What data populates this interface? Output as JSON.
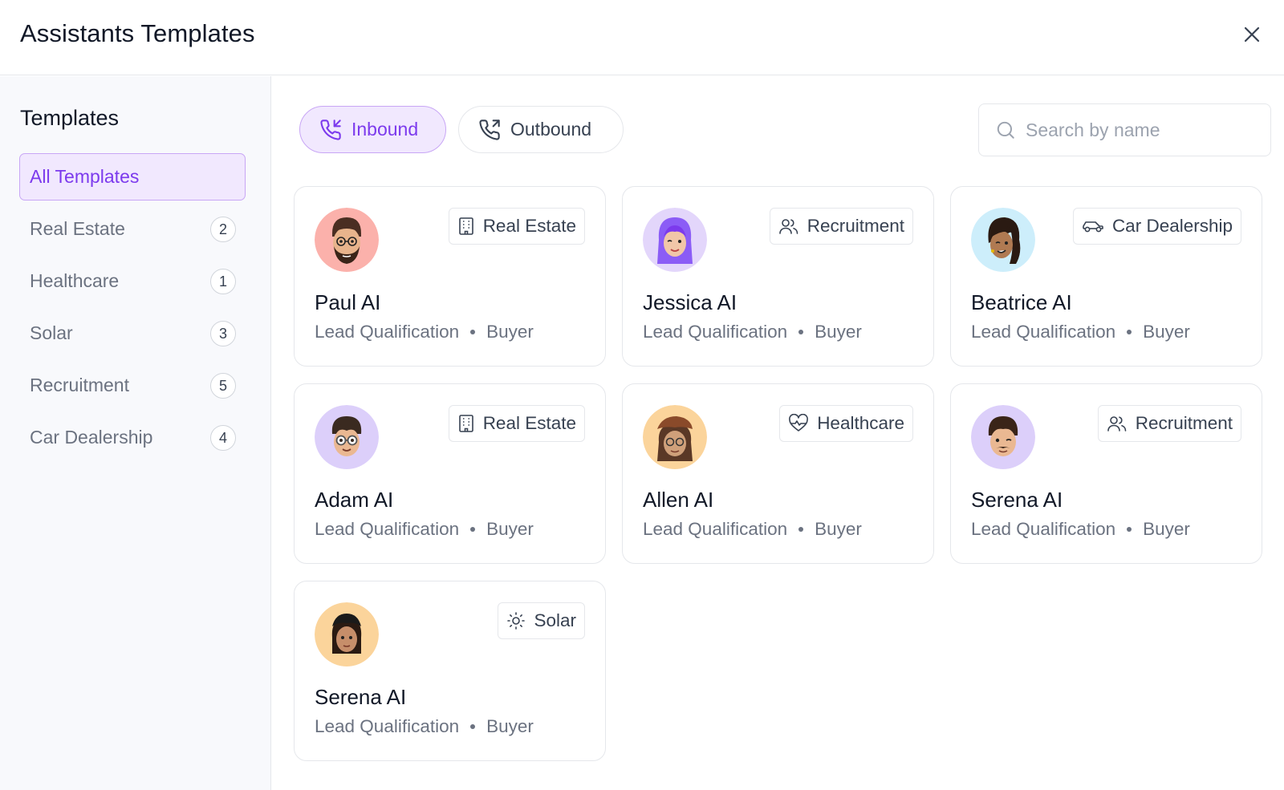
{
  "header": {
    "title": "Assistants Templates"
  },
  "sidebar": {
    "heading": "Templates",
    "items": [
      {
        "label": "All Templates",
        "count": null,
        "active": true
      },
      {
        "label": "Real Estate",
        "count": "2"
      },
      {
        "label": "Healthcare",
        "count": "1"
      },
      {
        "label": "Solar",
        "count": "3"
      },
      {
        "label": "Recruitment",
        "count": "5"
      },
      {
        "label": "Car Dealership",
        "count": "4"
      }
    ]
  },
  "toggles": {
    "inbound": "Inbound",
    "outbound": "Outbound",
    "selected": "Inbound"
  },
  "search": {
    "placeholder": "Search by name",
    "value": ""
  },
  "cards": [
    {
      "name": "Paul AI",
      "tag": "Real Estate",
      "tag_icon": "building-icon",
      "type": "Lead Qualification",
      "role": "Buyer",
      "avatar_bg": "#fbb1ab"
    },
    {
      "name": "Jessica AI",
      "tag": "Recruitment",
      "tag_icon": "users-icon",
      "type": "Lead Qualification",
      "role": "Buyer",
      "avatar_bg": "#e3d6fb"
    },
    {
      "name": "Beatrice AI",
      "tag": "Car Dealership",
      "tag_icon": "car-icon",
      "type": "Lead Qualification",
      "role": "Buyer",
      "avatar_bg": "#cdeefb"
    },
    {
      "name": "Adam AI",
      "tag": "Real Estate",
      "tag_icon": "building-icon",
      "type": "Lead Qualification",
      "role": "Buyer",
      "avatar_bg": "#dccffa"
    },
    {
      "name": "Allen AI",
      "tag": "Healthcare",
      "tag_icon": "heart-pulse-icon",
      "type": "Lead Qualification",
      "role": "Buyer",
      "avatar_bg": "#fbd49b"
    },
    {
      "name": "Serena AI",
      "tag": "Recruitment",
      "tag_icon": "users-icon",
      "type": "Lead Qualification",
      "role": "Buyer",
      "avatar_bg": "#dccffa"
    },
    {
      "name": "Serena AI",
      "tag": "Solar",
      "tag_icon": "sun-icon",
      "type": "Lead Qualification",
      "role": "Buyer",
      "avatar_bg": "#fbd49b"
    }
  ],
  "colors": {
    "accent": "#7c3aed",
    "accent_bg": "#f1e8fe",
    "accent_border": "#c8a6f5",
    "border": "#e5e7eb",
    "sidebar_bg": "#f8f9fc"
  }
}
